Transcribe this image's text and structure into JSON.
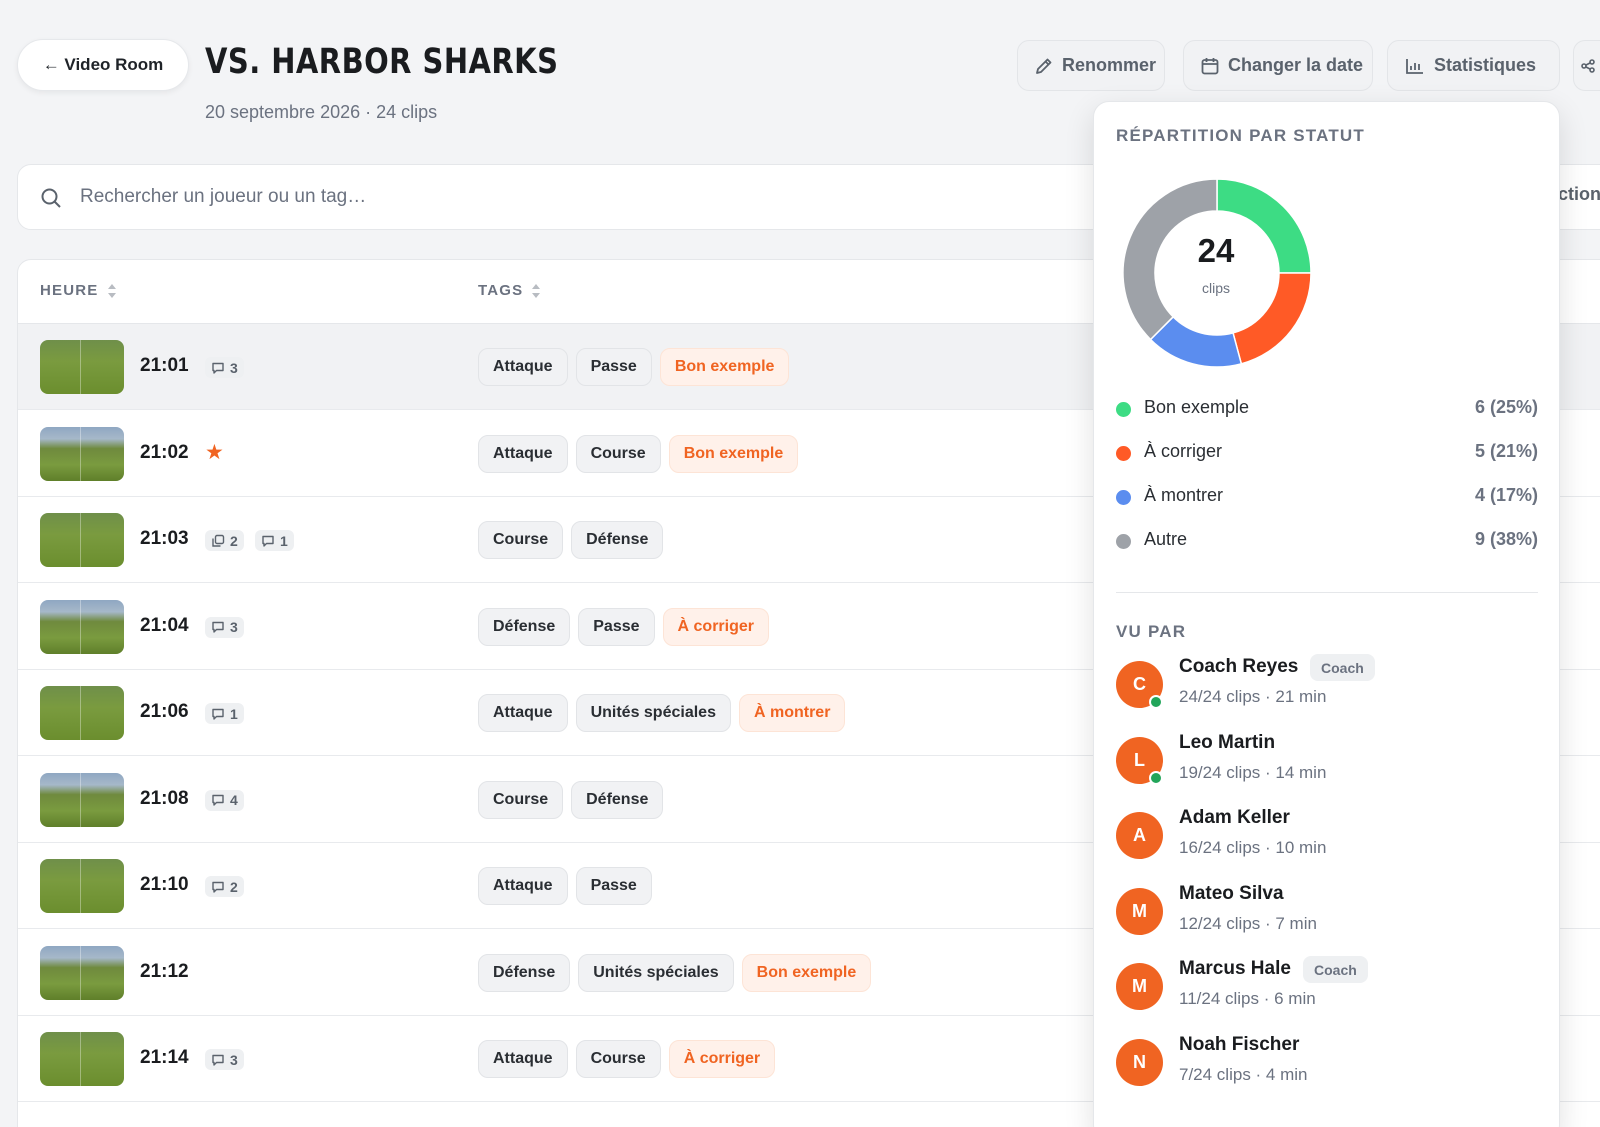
{
  "header": {
    "back_label": "← Video Room",
    "title": "VS. HARBOR SHARKS",
    "subtitle": "20 septembre 2026 · 24 clips"
  },
  "toolbar": {
    "rename_label": "Renommer",
    "change_date_label": "Changer la date",
    "stats_label": "Statistiques"
  },
  "search": {
    "placeholder": "Rechercher un joueur ou un tag…",
    "value": ""
  },
  "clipped_text": "ction",
  "table": {
    "columns": [
      "HEURE",
      "TAGS"
    ],
    "rows": [
      {
        "time": "21:01",
        "comments": "3",
        "tags": [
          "Attaque",
          "Passe"
        ],
        "status": "Bon exemple"
      },
      {
        "time": "21:02",
        "starred": true,
        "tags": [
          "Attaque",
          "Course"
        ],
        "status": "Bon exemple"
      },
      {
        "time": "21:03",
        "copies": "2",
        "comments": "1",
        "tags": [
          "Course",
          "Défense"
        ],
        "status": ""
      },
      {
        "time": "21:04",
        "comments": "3",
        "tags": [
          "Défense",
          "Passe"
        ],
        "status": "À corriger"
      },
      {
        "time": "21:06",
        "comments": "1",
        "tags": [
          "Attaque",
          "Unités spéciales"
        ],
        "status": "À montrer"
      },
      {
        "time": "21:08",
        "comments": "4",
        "tags": [
          "Course",
          "Défense"
        ],
        "status": ""
      },
      {
        "time": "21:10",
        "comments": "2",
        "tags": [
          "Attaque",
          "Passe"
        ],
        "status": ""
      },
      {
        "time": "21:12",
        "tags": [
          "Défense",
          "Unités spéciales"
        ],
        "status": "Bon exemple"
      },
      {
        "time": "21:14",
        "comments": "3",
        "tags": [
          "Attaque",
          "Course"
        ],
        "status": "À corriger"
      }
    ]
  },
  "stats_panel": {
    "status_heading": "RÉPARTITION PAR STATUT",
    "total": "24",
    "total_unit": "clips",
    "legend": [
      {
        "label": "Bon exemple",
        "value": "6 (25%)",
        "count": 6,
        "color": "#3ddc84"
      },
      {
        "label": "À corriger",
        "value": "5 (21%)",
        "count": 5,
        "color": "#ff5a26"
      },
      {
        "label": "À montrer",
        "value": "4 (17%)",
        "count": 4,
        "color": "#5b8def"
      },
      {
        "label": "Autre",
        "value": "9 (38%)",
        "count": 9,
        "color": "#9ea2a8"
      }
    ],
    "viewers_heading": "VU PAR",
    "viewers": [
      {
        "initial": "C",
        "name": "Coach Reyes",
        "role": "Coach",
        "meta": "24/24 clips · 21 min",
        "online": true
      },
      {
        "initial": "L",
        "name": "Leo Martin",
        "role": "",
        "meta": "19/24 clips · 14 min",
        "online": true
      },
      {
        "initial": "A",
        "name": "Adam Keller",
        "role": "",
        "meta": "16/24 clips · 10 min",
        "online": false
      },
      {
        "initial": "M",
        "name": "Mateo Silva",
        "role": "",
        "meta": "12/24 clips · 7 min",
        "online": false
      },
      {
        "initial": "M",
        "name": "Marcus Hale",
        "role": "Coach",
        "meta": "11/24 clips · 6 min",
        "online": false
      },
      {
        "initial": "N",
        "name": "Noah Fischer",
        "role": "",
        "meta": "7/24 clips · 4 min",
        "online": false
      }
    ]
  },
  "colors": {
    "accent": "#f06422",
    "online": "#22a55a"
  }
}
